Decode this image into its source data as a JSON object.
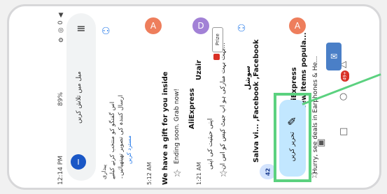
{
  "status_bar": {
    "time": "12:14 PM",
    "battery": "89%",
    "icons": "⚙ ◎ 0 ▲"
  },
  "search": {
    "placeholder": "میل میں تلاش کریں",
    "avatar_letter": "I"
  },
  "promo": {
    "label": "پیداری",
    "line1": "اس گفتگو کو منتخب کرنے کیلیے",
    "line2": "ارسال کنندہ کی تصویر تھپتھپائیں۔",
    "link": "مسترد کریں"
  },
  "emails": [
    {
      "sender": "AliExpress",
      "time": "5:12 AM",
      "subject": "We have a gift for you inside",
      "snippet": "Ending soon. Grab now!",
      "avatar_letter": "A",
      "avatar_color": "#ee7e5c"
    },
    {
      "sender": "Uzair",
      "time": "1:21 AM",
      "subject": "اپنی حیثیت کی اپنی",
      "snippet": "بہت بہت مبارکی ہو اپ جیٹ کپس کو اس ان...",
      "tag": "Prize",
      "avatar_letter": "D",
      "avatar_color": "#a281d6"
    },
    {
      "sender": "سوشل",
      "subject": "Salva vi... ,Facebook ,Facebook",
      "count_badge": "42",
      "avatar_letter": "",
      "avatar_color": "#1a73e8"
    },
    {
      "sender": "AliExpress",
      "subject": "New items popula...",
      "snippet": "Hurry, see deals in Earphones & He...",
      "avatar_letter": "A",
      "avatar_color": "#ee7e5c"
    }
  ],
  "fab": {
    "label": "تحریر کریں"
  },
  "mail_badge": "49+"
}
